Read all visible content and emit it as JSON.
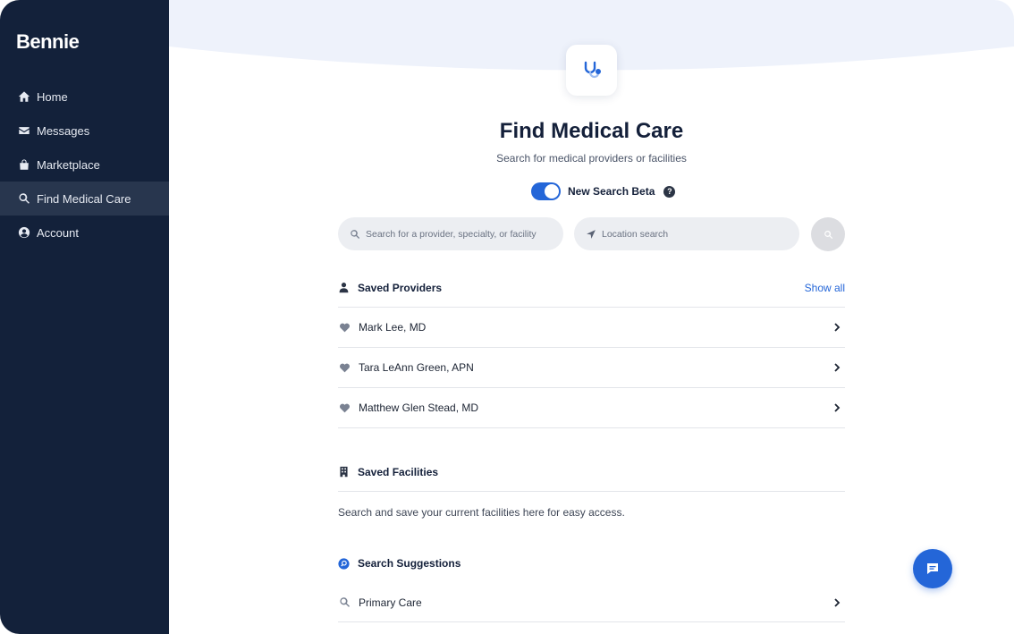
{
  "app": {
    "brand": "Bennie"
  },
  "sidebar": {
    "items": [
      {
        "label": "Home",
        "icon": "home-icon"
      },
      {
        "label": "Messages",
        "icon": "envelope-icon"
      },
      {
        "label": "Marketplace",
        "icon": "bag-icon"
      },
      {
        "label": "Find Medical Care",
        "icon": "search-icon",
        "active": true
      },
      {
        "label": "Account",
        "icon": "user-circle-icon"
      }
    ]
  },
  "header": {
    "title": "Find Medical Care",
    "subtitle": "Search for medical providers or facilities",
    "icon": "stethoscope-icon"
  },
  "toggle": {
    "label": "New Search Beta",
    "on": true
  },
  "search": {
    "provider_placeholder": "Search for a provider, specialty, or facility",
    "location_placeholder": "Location search"
  },
  "saved_providers": {
    "title": "Saved Providers",
    "show_all": "Show all",
    "items": [
      {
        "name": "Mark Lee, MD"
      },
      {
        "name": "Tara LeAnn Green, APN"
      },
      {
        "name": "Matthew Glen Stead, MD"
      }
    ]
  },
  "saved_facilities": {
    "title": "Saved Facilities",
    "empty_text": "Search and save your current facilities here for easy access."
  },
  "search_suggestions": {
    "title": "Search Suggestions",
    "items": [
      {
        "label": "Primary Care"
      }
    ]
  },
  "colors": {
    "sidebar_bg": "#13213a",
    "sidebar_active": "#28364e",
    "accent": "#2466d8",
    "hero_bg": "#eef2fb"
  }
}
